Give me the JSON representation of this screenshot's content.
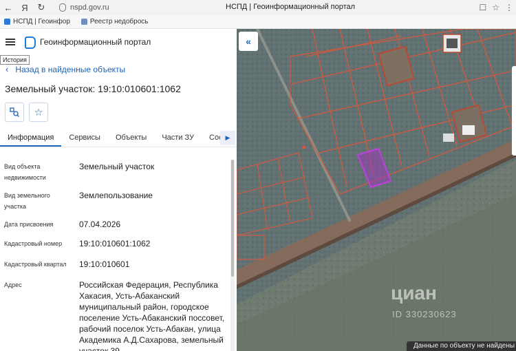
{
  "browser": {
    "url": "nspd.gov.ru",
    "tab_title": "НСПД | Геоинформационный портал",
    "bookmarks": [
      "НСПД | Геоинфор",
      "Реестр недобрось"
    ]
  },
  "app": {
    "title": "Геоинформационный портал",
    "tooltip": "История",
    "back_label": "Назад в найденные объекты",
    "object_title": "Земельный участок: 19:10:010601:1062"
  },
  "tabs": [
    {
      "label": "Информация",
      "active": true
    },
    {
      "label": "Сервисы"
    },
    {
      "label": "Объекты"
    },
    {
      "label": "Части ЗУ"
    },
    {
      "label": "Состав"
    }
  ],
  "properties": [
    {
      "key": "Вид объекта недвижимости",
      "value": "Земельный участок"
    },
    {
      "key": "Вид земельного участка",
      "value": "Землепользование"
    },
    {
      "key": "Дата присвоения",
      "value": "07.04.2026"
    },
    {
      "key": "Кадастровый номер",
      "value": "19:10:010601:1062"
    },
    {
      "key": "Кадастровый квартал",
      "value": "19:10:010601"
    },
    {
      "key": "Адрес",
      "value": "Российская Федерация, Республика Хакасия, Усть-Абаканский муниципальный район, городское поселение Усть-Абаканский поссовет, рабочий поселок Усть-Абакан, улица Академика А.Д.Сахарова, земельный участок 39"
    }
  ],
  "map": {
    "watermark": "циан",
    "watermark_id": "ID 330230623",
    "toast": "Данные по объекту не найдены"
  },
  "colors": {
    "accent": "#1f63b8",
    "parcel_border": "#d9573b",
    "selected_parcel": "#b23bd6"
  }
}
